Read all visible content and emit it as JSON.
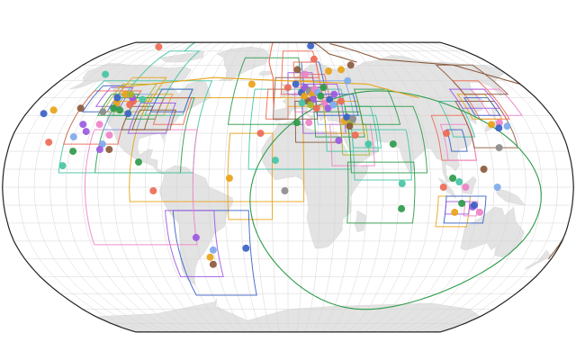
{
  "map": {
    "projection": "robinson",
    "background": "#ffffff",
    "land_color": "#e3e3e3",
    "graticule_color": "#d4d4d4",
    "outline_color": "#222222",
    "graticule_step_deg": 10
  },
  "palette": {
    "blue": "#3a62c4",
    "orange": "#e8a317",
    "green": "#2e9b4a",
    "red": "#ee6a55",
    "purple": "#9b59e0",
    "brown": "#8b5a3c",
    "pink": "#ee82c8",
    "gray": "#8c8c8c",
    "olive": "#a6b52a",
    "teal": "#45c4a5",
    "lightblue": "#7ea9ec"
  },
  "regions": [
    {
      "color": "orange",
      "lon": [
        -38,
        -10
      ],
      "lat": [
        -18,
        30
      ]
    },
    {
      "color": "orange",
      "lon": [
        -100,
        10
      ],
      "lat": [
        -8,
        50
      ]
    },
    {
      "color": "blue",
      "lon": [
        -73,
        -25
      ],
      "lat": [
        -61,
        -13
      ]
    },
    {
      "color": "purple",
      "lon": [
        -78,
        -47
      ],
      "lat": [
        -50,
        -13
      ]
    },
    {
      "color": "green",
      "lon": [
        -122,
        -68
      ],
      "lat": [
        8,
        50
      ]
    },
    {
      "color": "teal",
      "lon": [
        -145,
        -60
      ],
      "lat": [
        8,
        60
      ]
    },
    {
      "color": "teal",
      "lon": [
        -120,
        -90
      ],
      "lat": [
        40,
        80
      ]
    },
    {
      "color": "pink",
      "lon": [
        -128,
        -60
      ],
      "lat": [
        -32,
        32
      ]
    },
    {
      "color": "red",
      "lon": [
        -145,
        -110
      ],
      "lat": [
        24,
        54
      ]
    },
    {
      "color": "blue",
      "lon": [
        -142,
        -125
      ],
      "lat": [
        42,
        57
      ]
    },
    {
      "color": "purple",
      "lon": [
        -135,
        -118
      ],
      "lat": [
        45,
        56
      ]
    },
    {
      "color": "olive",
      "lon": [
        -128,
        -102
      ],
      "lat": [
        42,
        58
      ]
    },
    {
      "color": "lightblue",
      "lon": [
        -122,
        -100
      ],
      "lat": [
        32,
        52
      ]
    },
    {
      "color": "green",
      "lon": [
        -110,
        -90
      ],
      "lat": [
        38,
        50
      ]
    },
    {
      "color": "brown",
      "lon": [
        -110,
        -95
      ],
      "lat": [
        32,
        45
      ]
    },
    {
      "color": "orange",
      "lon": [
        -100,
        -85
      ],
      "lat": [
        40,
        52
      ]
    },
    {
      "color": "red",
      "lon": [
        -90,
        -70
      ],
      "lat": [
        35,
        50
      ]
    },
    {
      "color": "purple",
      "lon": [
        -105,
        -80
      ],
      "lat": [
        30,
        47
      ]
    },
    {
      "color": "teal",
      "lon": [
        -98,
        -72
      ],
      "lat": [
        40,
        55
      ]
    },
    {
      "color": "blue",
      "lon": [
        -95,
        -72
      ],
      "lat": [
        42,
        55
      ]
    },
    {
      "color": "brown",
      "lon": [
        -103,
        -78
      ],
      "lat": [
        32,
        43
      ]
    },
    {
      "color": "orange",
      "lon": [
        -125,
        -98
      ],
      "lat": [
        48,
        62
      ]
    },
    {
      "color": "green",
      "lon": [
        -130,
        -110
      ],
      "lat": [
        40,
        52
      ]
    },
    {
      "color": "teal",
      "lon": [
        -25,
        40
      ],
      "lat": [
        10,
        55
      ]
    },
    {
      "color": "green",
      "lon": [
        -40,
        10
      ],
      "lat": [
        35,
        75
      ]
    },
    {
      "color": "red",
      "lon": [
        -15,
        0
      ],
      "lat": [
        38,
        55
      ]
    },
    {
      "color": "orange",
      "lon": [
        0,
        25
      ],
      "lat": [
        45,
        60
      ]
    },
    {
      "color": "pink",
      "lon": [
        5,
        28
      ],
      "lat": [
        42,
        56
      ]
    },
    {
      "color": "purple",
      "lon": [
        10,
        38
      ],
      "lat": [
        30,
        58
      ]
    },
    {
      "color": "lightblue",
      "lon": [
        20,
        45
      ],
      "lat": [
        35,
        60
      ]
    },
    {
      "color": "red",
      "lon": [
        10,
        30
      ],
      "lat": [
        50,
        64
      ]
    },
    {
      "color": "blue",
      "lon": [
        12,
        28
      ],
      "lat": [
        56,
        72
      ]
    },
    {
      "color": "brown",
      "lon": [
        -10,
        20
      ],
      "lat": [
        38,
        62
      ]
    },
    {
      "color": "red",
      "lon": [
        5,
        25
      ],
      "lat": [
        62,
        72
      ]
    },
    {
      "color": "brown",
      "lon": [
        5,
        35
      ],
      "lat": [
        25,
        48
      ]
    },
    {
      "color": "green",
      "lon": [
        18,
        50
      ],
      "lat": [
        28,
        42
      ]
    },
    {
      "color": "teal",
      "lon": [
        25,
        58
      ],
      "lat": [
        20,
        45
      ]
    },
    {
      "color": "orange",
      "lon": [
        25,
        50
      ],
      "lat": [
        30,
        48
      ]
    },
    {
      "color": "pink",
      "lon": [
        28,
        55
      ],
      "lat": [
        12,
        35
      ]
    },
    {
      "color": "olive",
      "lon": [
        35,
        52
      ],
      "lat": [
        18,
        35
      ]
    },
    {
      "color": "green",
      "lon": [
        40,
        88
      ],
      "lat": [
        8,
        45
      ]
    },
    {
      "color": "teal",
      "lon": [
        42,
        60
      ],
      "lat": [
        22,
        40
      ]
    },
    {
      "color": "teal",
      "lon": [
        42,
        78
      ],
      "lat": [
        4,
        32
      ]
    },
    {
      "color": "green",
      "lon": [
        38,
        80
      ],
      "lat": [
        -20,
        14
      ]
    },
    {
      "color": "red",
      "lon": [
        98,
        120
      ],
      "lat": [
        15,
        40
      ]
    },
    {
      "color": "teal",
      "lon": [
        108,
        122
      ],
      "lat": [
        28,
        48
      ]
    },
    {
      "color": "pink",
      "lon": [
        102,
        120
      ],
      "lat": [
        15,
        35
      ]
    },
    {
      "color": "blue",
      "lon": [
        105,
        115
      ],
      "lat": [
        20,
        32
      ]
    },
    {
      "color": "brown",
      "lon": [
        120,
        148
      ],
      "lat": [
        22,
        48
      ]
    },
    {
      "color": "red",
      "lon": [
        130,
        150
      ],
      "lat": [
        38,
        60
      ]
    },
    {
      "color": "pink",
      "lon": [
        138,
        160
      ],
      "lat": [
        40,
        55
      ]
    },
    {
      "color": "orange",
      "lon": [
        125,
        145
      ],
      "lat": [
        38,
        52
      ]
    },
    {
      "color": "blue",
      "lon": [
        128,
        145
      ],
      "lat": [
        40,
        50
      ]
    },
    {
      "color": "purple",
      "lon": [
        122,
        148
      ],
      "lat": [
        44,
        55
      ]
    },
    {
      "color": "brown",
      "lon": [
        130,
        162
      ],
      "lat": [
        52,
        70
      ]
    },
    {
      "color": "orange",
      "lon": [
        95,
        115
      ],
      "lat": [
        -22,
        -5
      ]
    },
    {
      "color": "blue",
      "lon": [
        100,
        125
      ],
      "lat": [
        -20,
        -5
      ]
    },
    {
      "color": "pink",
      "lon": [
        112,
        120
      ],
      "lat": [
        -16,
        -8
      ]
    },
    {
      "color": "purple",
      "lon": [
        100,
        115
      ],
      "lat": [
        -15,
        -8
      ]
    },
    {
      "color": "red",
      "lon": [
        -5,
        25
      ],
      "lat": [
        52,
        80
      ]
    },
    {
      "color": "purple",
      "lon": [
        0,
        20
      ],
      "lat": [
        52,
        65
      ]
    },
    {
      "color": "green",
      "lon": [
        50,
        75
      ],
      "lat": [
        35,
        55
      ]
    },
    {
      "color": "blue",
      "lon": [
        20,
        48
      ],
      "lat": [
        40,
        52
      ]
    }
  ],
  "large_shapes": [
    {
      "color": "green",
      "kind": "ellipse",
      "lon_c": 68,
      "lat_c": -8,
      "lon_r": 92,
      "lat_r": 62
    },
    {
      "color": "brown",
      "kind": "arc",
      "points": [
        [
          48,
          88
        ],
        [
          85,
          74
        ],
        [
          145,
          70
        ],
        [
          180,
          58
        ],
        [
          185,
          0
        ],
        [
          178,
          -40
        ]
      ]
    },
    {
      "color": "brown",
      "kind": "arc",
      "points": [
        [
          30,
          90
        ],
        [
          40,
          78
        ],
        [
          62,
          72
        ]
      ]
    },
    {
      "color": "red",
      "kind": "arc",
      "points": [
        [
          -18,
          90
        ],
        [
          -17,
          72
        ],
        [
          -12,
          62
        ],
        [
          -10,
          45
        ]
      ]
    },
    {
      "color": "orange",
      "kind": "arc",
      "points": [
        [
          -130,
          56
        ],
        [
          -60,
          62
        ],
        [
          0,
          60
        ],
        [
          62,
          58
        ],
        [
          95,
          50
        ]
      ]
    },
    {
      "color": "teal",
      "kind": "arc",
      "points": [
        [
          -105,
          80
        ],
        [
          -110,
          90
        ]
      ]
    }
  ],
  "points": [
    {
      "color": "red",
      "lon": -140,
      "lat": 84
    },
    {
      "color": "orange",
      "lon": -28,
      "lat": 58
    },
    {
      "color": "teal",
      "lon": -150,
      "lat": 64
    },
    {
      "color": "blue",
      "lon": 25,
      "lat": 85
    },
    {
      "color": "red",
      "lon": 24,
      "lat": 74
    },
    {
      "color": "brown",
      "lon": 8,
      "lat": 67
    },
    {
      "color": "pink",
      "lon": 14,
      "lat": 64
    },
    {
      "color": "orange",
      "lon": 34,
      "lat": 66
    },
    {
      "color": "lightblue",
      "lon": 47,
      "lat": 60
    },
    {
      "color": "brown",
      "lon": 55,
      "lat": 70
    },
    {
      "color": "orange",
      "lon": 45,
      "lat": 67
    },
    {
      "color": "blue",
      "lon": 6,
      "lat": 58
    },
    {
      "color": "red",
      "lon": 0,
      "lat": 56
    },
    {
      "color": "blue",
      "lon": 10,
      "lat": 53
    },
    {
      "color": "purple",
      "lon": 13,
      "lat": 56
    },
    {
      "color": "gray",
      "lon": 16,
      "lat": 54
    },
    {
      "color": "orange",
      "lon": 18,
      "lat": 52
    },
    {
      "color": "pink",
      "lon": 20,
      "lat": 55
    },
    {
      "color": "lightblue",
      "lon": 22,
      "lat": 53
    },
    {
      "color": "green",
      "lon": 24,
      "lat": 51
    },
    {
      "color": "purple",
      "lon": 18,
      "lat": 49
    },
    {
      "color": "brown",
      "lon": 14,
      "lat": 48
    },
    {
      "color": "olive",
      "lon": 16,
      "lat": 46
    },
    {
      "color": "teal",
      "lon": 10,
      "lat": 47
    },
    {
      "color": "red",
      "lon": 20,
      "lat": 44
    },
    {
      "color": "pink",
      "lon": 26,
      "lat": 47
    },
    {
      "color": "blue",
      "lon": 30,
      "lat": 49
    },
    {
      "color": "purple",
      "lon": 34,
      "lat": 52
    },
    {
      "color": "red",
      "lon": 38,
      "lat": 48
    },
    {
      "color": "green",
      "lon": 27,
      "lat": 56
    },
    {
      "color": "orange",
      "lon": 12,
      "lat": 51
    },
    {
      "color": "purple",
      "lon": 28,
      "lat": 44
    },
    {
      "color": "lightblue",
      "lon": 32,
      "lat": 46
    },
    {
      "color": "green",
      "lon": 6,
      "lat": 36
    },
    {
      "color": "pink",
      "lon": 14,
      "lat": 36
    },
    {
      "color": "red",
      "lon": -18,
      "lat": 30
    },
    {
      "color": "orange",
      "lon": 38,
      "lat": 37
    },
    {
      "color": "blue",
      "lon": 40,
      "lat": 39
    },
    {
      "color": "olive",
      "lon": 42,
      "lat": 36
    },
    {
      "color": "gray",
      "lon": 44,
      "lat": 38
    },
    {
      "color": "brown",
      "lon": 41,
      "lat": 34
    },
    {
      "color": "red",
      "lon": 44,
      "lat": 29
    },
    {
      "color": "purple",
      "lon": 33,
      "lat": 26
    },
    {
      "color": "teal",
      "lon": 52,
      "lat": 24
    },
    {
      "color": "green",
      "lon": 68,
      "lat": 24
    },
    {
      "color": "red",
      "lon": 104,
      "lat": 30
    },
    {
      "color": "pink",
      "lon": 142,
      "lat": 36
    },
    {
      "color": "orange",
      "lon": 136,
      "lat": 35
    },
    {
      "color": "blue",
      "lon": 140,
      "lat": 33
    },
    {
      "color": "lightblue",
      "lon": 146,
      "lat": 34
    },
    {
      "color": "gray",
      "lon": 136,
      "lat": 22
    },
    {
      "color": "brown",
      "lon": 124,
      "lat": 10
    },
    {
      "color": "green",
      "lon": 104,
      "lat": 5
    },
    {
      "color": "red",
      "lon": 98,
      "lat": 0
    },
    {
      "color": "pink",
      "lon": 112,
      "lat": 0
    },
    {
      "color": "teal",
      "lon": 108,
      "lat": 3
    },
    {
      "color": "lightblue",
      "lon": 132,
      "lat": 0
    },
    {
      "color": "green",
      "lon": 110,
      "lat": -9
    },
    {
      "color": "purple",
      "lon": 117,
      "lat": -11
    },
    {
      "color": "blue",
      "lon": 118,
      "lat": -10
    },
    {
      "color": "orange",
      "lon": 106,
      "lat": -14
    },
    {
      "color": "pink",
      "lon": 122,
      "lat": -14
    },
    {
      "color": "teal",
      "lon": 72,
      "lat": 2
    },
    {
      "color": "green",
      "lon": 72,
      "lat": -12
    },
    {
      "color": "teal",
      "lon": -8,
      "lat": 15
    },
    {
      "color": "gray",
      "lon": -2,
      "lat": -2
    },
    {
      "color": "orange",
      "lon": -37,
      "lat": 5
    },
    {
      "color": "red",
      "lon": -85,
      "lat": -2
    },
    {
      "color": "blue",
      "lon": -28,
      "lat": -34
    },
    {
      "color": "purple",
      "lon": -60,
      "lat": -28
    },
    {
      "color": "lightblue",
      "lon": -50,
      "lat": -35
    },
    {
      "color": "brown",
      "lon": -52,
      "lat": -43
    },
    {
      "color": "orange",
      "lon": -53,
      "lat": -39
    },
    {
      "color": "teal",
      "lon": -143,
      "lat": 12
    },
    {
      "color": "red",
      "lon": -155,
      "lat": 25
    },
    {
      "color": "orange",
      "lon": -163,
      "lat": 43
    },
    {
      "color": "blue",
      "lon": -168,
      "lat": 41
    },
    {
      "color": "purple",
      "lon": -133,
      "lat": 31
    },
    {
      "color": "lightblue",
      "lon": -140,
      "lat": 28
    },
    {
      "color": "green",
      "lon": -138,
      "lat": 20
    },
    {
      "color": "pink",
      "lon": -126,
      "lat": 35
    },
    {
      "color": "purple",
      "lon": -137,
      "lat": 35
    },
    {
      "color": "brown",
      "lon": -145,
      "lat": 44
    },
    {
      "color": "orange",
      "lon": -122,
      "lat": 47
    },
    {
      "color": "gray",
      "lon": -128,
      "lat": 42
    },
    {
      "color": "green",
      "lon": -117,
      "lat": 43
    },
    {
      "color": "teal",
      "lon": -105,
      "lat": 49
    },
    {
      "color": "blue",
      "lon": -124,
      "lat": 50
    },
    {
      "color": "red",
      "lon": -111,
      "lat": 48
    },
    {
      "color": "orange",
      "lon": -120,
      "lat": 52
    },
    {
      "color": "purple",
      "lon": -113,
      "lat": 50
    },
    {
      "color": "pink",
      "lon": -117,
      "lat": 29
    },
    {
      "color": "brown",
      "lon": -115,
      "lat": 21
    },
    {
      "color": "red",
      "lon": -112,
      "lat": 46
    },
    {
      "color": "lightblue",
      "lon": -120,
      "lat": 24
    },
    {
      "color": "green",
      "lon": -122,
      "lat": 44
    },
    {
      "color": "purple",
      "lon": -121,
      "lat": 21
    },
    {
      "color": "green",
      "lon": -95,
      "lat": 14
    },
    {
      "color": "blue",
      "lon": -110,
      "lat": 41
    },
    {
      "color": "olive",
      "lon": -116,
      "lat": 52
    }
  ]
}
